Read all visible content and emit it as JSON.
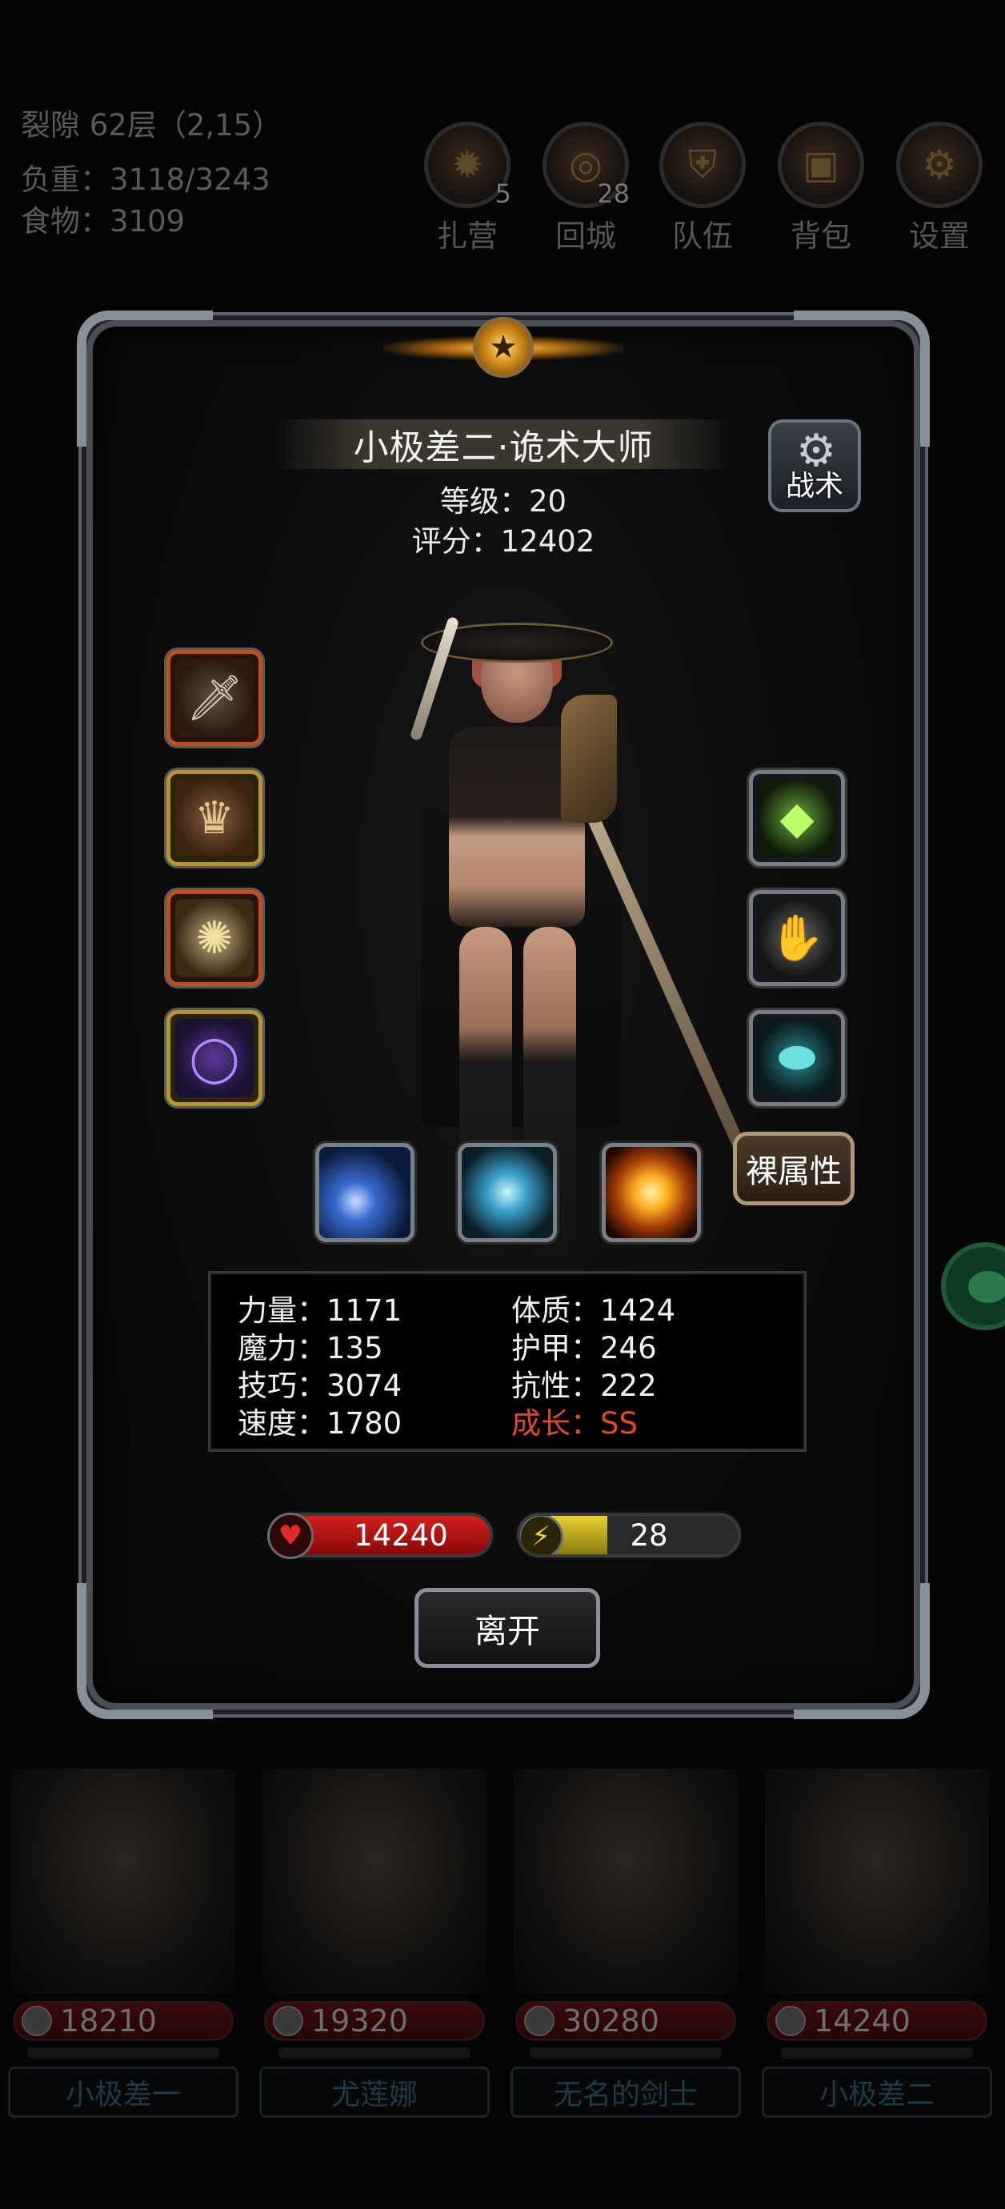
{
  "hud": {
    "location": "裂隙 62层（2,15）",
    "weight": "负重：3118/3243",
    "food": "食物：3109"
  },
  "top_buttons": [
    {
      "label": "扎营",
      "badge": "5",
      "icon": "campfire-icon"
    },
    {
      "label": "回城",
      "badge": "28",
      "icon": "portal-icon"
    },
    {
      "label": "队伍",
      "badge": "",
      "icon": "shield-icon"
    },
    {
      "label": "背包",
      "badge": "",
      "icon": "chest-icon"
    },
    {
      "label": "设置",
      "badge": "",
      "icon": "gear-icon"
    }
  ],
  "character": {
    "title": "小极差二·诡术大师",
    "level": "等级：20",
    "score": "评分：12402",
    "tactics_label": "战术",
    "naked_stats_label": "裸属性"
  },
  "equipment_left": [
    {
      "name": "weapon",
      "icon": "blade-icon",
      "rarity": "orange"
    },
    {
      "name": "helm",
      "icon": "helmet-icon",
      "rarity": "gold"
    },
    {
      "name": "amulet",
      "icon": "amulet-icon",
      "rarity": "orange"
    },
    {
      "name": "ring",
      "icon": "ring-icon",
      "rarity": "gold"
    }
  ],
  "equipment_right": [
    {
      "name": "crystal",
      "icon": "crystal-icon",
      "rarity": "grey"
    },
    {
      "name": "gauntlet",
      "icon": "gauntlet-icon",
      "rarity": "grey"
    },
    {
      "name": "stone",
      "icon": "stone-icon",
      "rarity": "grey"
    }
  ],
  "skills": [
    {
      "icon": "light-beam-icon"
    },
    {
      "icon": "slash-icon"
    },
    {
      "icon": "explosion-icon"
    }
  ],
  "stats": {
    "strength": "力量：1171",
    "constitution": "体质：1424",
    "magic": "魔力：135",
    "armor": "护甲：246",
    "skill": "技巧：3074",
    "resistance": "抗性：222",
    "speed": "速度：1780",
    "growth": "成长：SS"
  },
  "hp": "14240",
  "energy": {
    "value": "28",
    "fill_percent": 40
  },
  "leave_label": "离开",
  "party": [
    {
      "hp": "18210",
      "name": "小极差一"
    },
    {
      "hp": "19320",
      "name": "尤莲娜"
    },
    {
      "hp": "30280",
      "name": "无名的剑士"
    },
    {
      "hp": "14240",
      "name": "小极差二"
    }
  ],
  "colors": {
    "hp_red": "#d42020",
    "energy_yellow": "#e8d030",
    "growth_red": "#e04a2a",
    "rarity_orange": "#c0501a",
    "rarity_gold": "#b8962e"
  }
}
